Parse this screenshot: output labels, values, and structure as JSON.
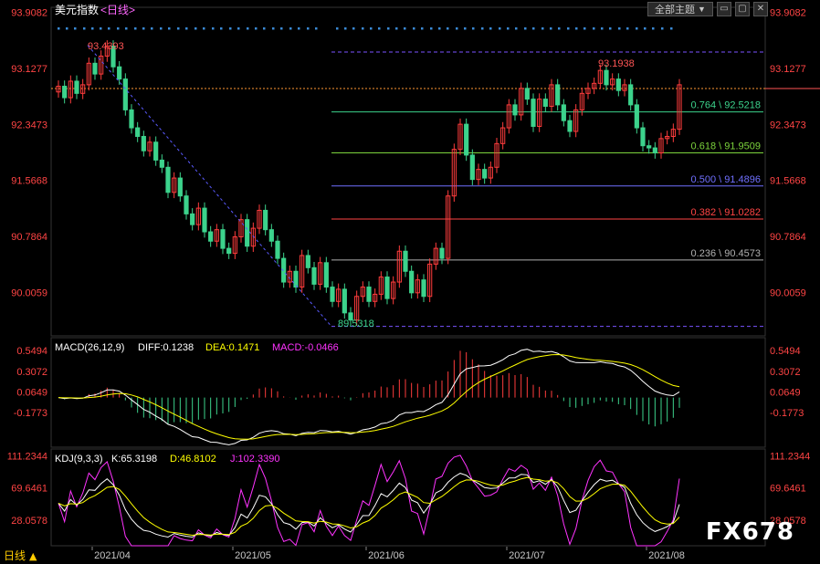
{
  "header": {
    "title": "美元指数",
    "period": "<日线>",
    "theme_button": "全部主题",
    "theme_arrow": "▼"
  },
  "toolbar_icons": [
    "minimize-icon",
    "restore-icon",
    "close-icon"
  ],
  "bottom_bar": {
    "period_label": "日线",
    "period_arrow": "▲"
  },
  "watermark": "FX678",
  "colors": {
    "up": "#ff3c3c",
    "down": "#3cd38c",
    "macd_diff": "#ffffff",
    "macd_dea": "#ffff00",
    "kdj_j": "#ff33ff",
    "price_axis": "#ff4444"
  },
  "chart_data": [
    {
      "type": "candlestick",
      "name": "price",
      "price_axis_ticks": [
        "93.9082",
        "93.1277",
        "92.3473",
        "91.5668",
        "90.7864",
        "90.0059"
      ],
      "ylim": [
        89.4,
        93.98
      ],
      "x_ticks": [
        "2021/04",
        "2021/05",
        "2021/06",
        "2021/07",
        "2021/08"
      ],
      "annotations": {
        "high": "93.4393",
        "low": "89.5318",
        "high2": "93.1938"
      },
      "fib_levels": [
        {
          "label": "0.764 \\ 92.5218",
          "value": 92.5218,
          "color": "#3cd38c"
        },
        {
          "label": "0.618 \\ 91.9509",
          "value": 91.9509,
          "color": "#7cd33c"
        },
        {
          "label": "0.500 \\ 91.4896",
          "value": 91.4896,
          "color": "#7070ff"
        },
        {
          "label": "0.382 \\ 91.0282",
          "value": 91.0282,
          "color": "#ff4444"
        },
        {
          "label": "0.236 \\ 90.4573",
          "value": 90.4573,
          "color": "#b0b0b0"
        }
      ],
      "fib_range": {
        "high": 93.1938,
        "low": 89.5318
      },
      "current_price": 92.847,
      "closes": [
        92.88,
        92.72,
        92.95,
        92.78,
        92.9,
        93.2,
        93.05,
        93.3,
        93.44,
        93.15,
        92.98,
        92.55,
        92.3,
        92.18,
        91.98,
        92.1,
        91.85,
        91.75,
        91.4,
        91.6,
        91.35,
        91.1,
        90.95,
        91.18,
        90.85,
        90.72,
        90.88,
        90.62,
        90.55,
        90.78,
        91.02,
        90.65,
        90.9,
        91.15,
        90.88,
        90.72,
        90.48,
        90.15,
        90.3,
        90.08,
        90.52,
        90.35,
        90.12,
        90.42,
        90.08,
        89.88,
        90.05,
        89.72,
        89.62,
        89.95,
        90.08,
        89.88,
        89.98,
        90.22,
        89.92,
        90.15,
        90.58,
        90.3,
        90.0,
        90.18,
        89.95,
        90.4,
        90.62,
        90.48,
        91.35,
        92.0,
        92.35,
        91.92,
        91.58,
        91.72,
        91.6,
        91.75,
        92.08,
        92.3,
        92.62,
        92.48,
        92.85,
        92.7,
        92.32,
        92.7,
        92.6,
        92.9,
        92.62,
        92.4,
        92.25,
        92.55,
        92.78,
        92.85,
        92.92,
        93.1,
        92.9,
        92.98,
        92.82,
        92.9,
        92.62,
        92.3,
        92.05,
        92.02,
        91.95,
        92.15,
        92.18,
        92.28,
        92.9
      ],
      "candles": [
        [
          92.8,
          92.88
        ],
        [
          92.88,
          92.72
        ],
        [
          92.72,
          92.95
        ],
        [
          92.95,
          92.78
        ],
        [
          92.78,
          92.9
        ],
        [
          92.9,
          93.2
        ],
        [
          93.2,
          93.05
        ],
        [
          93.05,
          93.3
        ],
        [
          93.3,
          93.44
        ],
        [
          93.44,
          93.15
        ],
        [
          93.15,
          92.98
        ],
        [
          92.98,
          92.55
        ],
        [
          92.55,
          92.3
        ],
        [
          92.3,
          92.18
        ],
        [
          92.18,
          91.98
        ],
        [
          91.98,
          92.1
        ],
        [
          92.1,
          91.85
        ],
        [
          91.85,
          91.75
        ],
        [
          91.75,
          91.4
        ],
        [
          91.4,
          91.6
        ],
        [
          91.6,
          91.35
        ],
        [
          91.35,
          91.1
        ],
        [
          91.1,
          90.95
        ],
        [
          90.95,
          91.18
        ],
        [
          91.18,
          90.85
        ],
        [
          90.85,
          90.72
        ],
        [
          90.72,
          90.88
        ],
        [
          90.88,
          90.62
        ],
        [
          90.62,
          90.55
        ],
        [
          90.55,
          90.78
        ],
        [
          90.78,
          91.02
        ],
        [
          91.02,
          90.65
        ],
        [
          90.65,
          90.9
        ],
        [
          90.9,
          91.15
        ],
        [
          91.15,
          90.88
        ],
        [
          90.88,
          90.72
        ],
        [
          90.72,
          90.48
        ],
        [
          90.48,
          90.15
        ],
        [
          90.15,
          90.3
        ],
        [
          90.3,
          90.08
        ],
        [
          90.08,
          90.52
        ],
        [
          90.52,
          90.35
        ],
        [
          90.35,
          90.12
        ],
        [
          90.12,
          90.42
        ],
        [
          90.42,
          90.08
        ],
        [
          90.08,
          89.88
        ],
        [
          89.88,
          90.05
        ],
        [
          90.05,
          89.72
        ],
        [
          89.72,
          89.62
        ],
        [
          89.62,
          89.95
        ],
        [
          89.95,
          90.08
        ],
        [
          90.08,
          89.88
        ],
        [
          89.88,
          89.98
        ],
        [
          89.98,
          90.22
        ],
        [
          90.22,
          89.92
        ],
        [
          89.92,
          90.15
        ],
        [
          90.15,
          90.58
        ],
        [
          90.58,
          90.3
        ],
        [
          90.3,
          90.0
        ],
        [
          90.0,
          90.18
        ],
        [
          90.18,
          89.95
        ],
        [
          89.95,
          90.4
        ],
        [
          90.4,
          90.62
        ],
        [
          90.62,
          90.48
        ],
        [
          90.48,
          91.35
        ],
        [
          91.35,
          92.0
        ],
        [
          92.0,
          92.35
        ],
        [
          92.35,
          91.92
        ],
        [
          91.92,
          91.58
        ],
        [
          91.58,
          91.72
        ],
        [
          91.72,
          91.6
        ],
        [
          91.6,
          91.75
        ],
        [
          91.75,
          92.08
        ],
        [
          92.08,
          92.3
        ],
        [
          92.3,
          92.62
        ],
        [
          92.62,
          92.48
        ],
        [
          92.48,
          92.85
        ],
        [
          92.85,
          92.7
        ],
        [
          92.7,
          92.32
        ],
        [
          92.32,
          92.7
        ],
        [
          92.7,
          92.6
        ],
        [
          92.6,
          92.9
        ],
        [
          92.9,
          92.62
        ],
        [
          92.62,
          92.4
        ],
        [
          92.4,
          92.25
        ],
        [
          92.25,
          92.55
        ],
        [
          92.55,
          92.78
        ],
        [
          92.78,
          92.85
        ],
        [
          92.85,
          92.92
        ],
        [
          92.92,
          93.1
        ],
        [
          93.1,
          92.9
        ],
        [
          92.9,
          92.98
        ],
        [
          92.98,
          92.82
        ],
        [
          92.82,
          92.9
        ],
        [
          92.9,
          92.62
        ],
        [
          92.62,
          92.3
        ],
        [
          92.3,
          92.05
        ],
        [
          92.05,
          92.02
        ],
        [
          92.02,
          91.95
        ],
        [
          91.95,
          92.15
        ],
        [
          92.15,
          92.18
        ],
        [
          92.18,
          92.28
        ],
        [
          92.28,
          92.9
        ]
      ]
    },
    {
      "type": "line+bar",
      "name": "MACD",
      "label": "MACD(26,12,9)",
      "diff_label": "DIFF:0.1238",
      "dea_label": "DEA:0.1471",
      "macd_label": "MACD:-0.0466",
      "axis_ticks": [
        "0.5494",
        "0.3072",
        "0.0649",
        "-0.1773"
      ],
      "ylim": [
        -0.58,
        0.7
      ]
    },
    {
      "type": "line",
      "name": "KDJ",
      "label": "KDJ(9,3,3)",
      "k_label": "K:65.3198",
      "d_label": "D:46.8102",
      "j_label": "J:102.3390",
      "axis_ticks": [
        "111.2344",
        "69.6461",
        "28.0578"
      ],
      "ylim": [
        -5,
        120
      ]
    }
  ]
}
